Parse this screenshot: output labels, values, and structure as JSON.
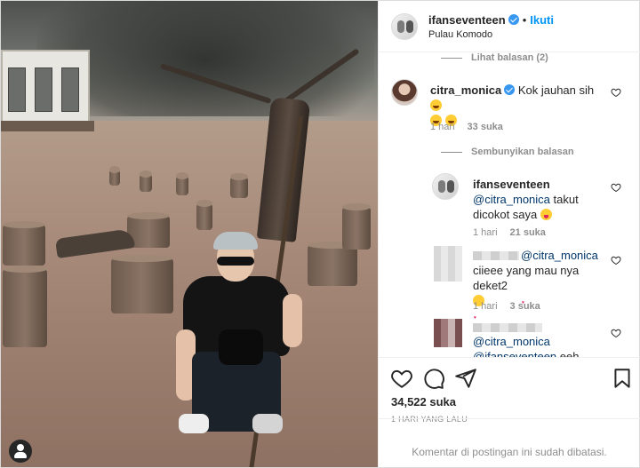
{
  "post": {
    "author": "ifanseventeen",
    "follow_label": "Ikuti",
    "separator": "•",
    "location": "Pulau Komodo"
  },
  "comments": {
    "view_replies": "Lihat balasan (2)",
    "main": {
      "username": "citra_monica",
      "text": "Kok jauhan sih",
      "time": "1 hari",
      "likes": "33 suka"
    },
    "hide_replies": "Sembunyikan balasan",
    "replies": [
      {
        "username": "ifanseventeen",
        "mention": "@citra_monica",
        "text": "takut dicokot saya",
        "time": "1 hari",
        "likes": "21 suka"
      },
      {
        "mention": "@citra_monica",
        "text": "ciieee yang mau nya deket2",
        "time": "1 hari",
        "likes": "3 suka"
      },
      {
        "mention": "@citra_monica",
        "mention2": "@ifanseventeen",
        "text_partial": "eeh"
      }
    ]
  },
  "actions": {
    "likes": "34,522 suka",
    "timestamp": "1 HARI YANG LALU",
    "comments_disabled": "Komentar di postingan ini sudah dibatasi."
  },
  "icons": {
    "like": "heart-icon",
    "comment": "comment-icon",
    "share": "paper-plane-icon",
    "save": "bookmark-icon",
    "verified": "verified-badge-icon",
    "user_tag": "user-tag-icon"
  },
  "colors": {
    "follow_blue": "#0095f6",
    "verified_blue": "#3897f0",
    "mention": "#00376b",
    "muted": "#8e8e8e"
  }
}
